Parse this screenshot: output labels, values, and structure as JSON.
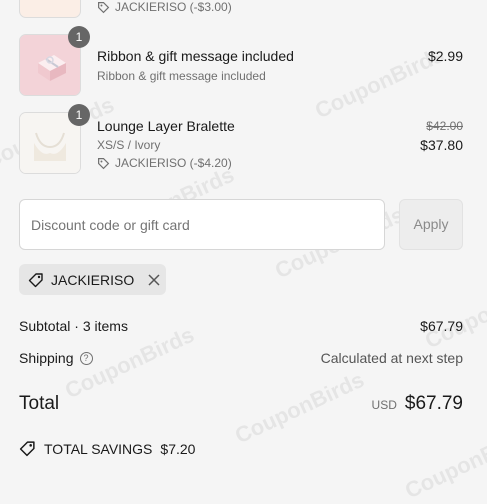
{
  "items": [
    {
      "quantity": "",
      "name": "",
      "variant": "",
      "discount": "JACKIERISO (-$3.00)",
      "price": "",
      "original_price": ""
    },
    {
      "quantity": "1",
      "name": "Ribbon & gift message included",
      "variant": "Ribbon & gift message included",
      "discount": "",
      "price": "$2.99",
      "original_price": ""
    },
    {
      "quantity": "1",
      "name": "Lounge Layer Bralette",
      "variant": "XS/S / Ivory",
      "discount": "JACKIERISO (-$4.20)",
      "price": "$37.80",
      "original_price": "$42.00"
    }
  ],
  "discount_input": {
    "placeholder": "Discount code or gift card",
    "apply_label": "Apply"
  },
  "applied_code": {
    "code": "JACKIERISO"
  },
  "summary": {
    "subtotal_label": "Subtotal · 3 items",
    "subtotal_value": "$67.79",
    "shipping_label": "Shipping",
    "shipping_value": "Calculated at next step",
    "total_label": "Total",
    "total_currency": "USD",
    "total_value": "$67.79",
    "savings_label": "TOTAL SAVINGS",
    "savings_value": "$7.20"
  },
  "watermark": "CouponBirds",
  "colors": {
    "background": "#f5f5f5",
    "badge": "#666666",
    "muted": "#707070"
  }
}
